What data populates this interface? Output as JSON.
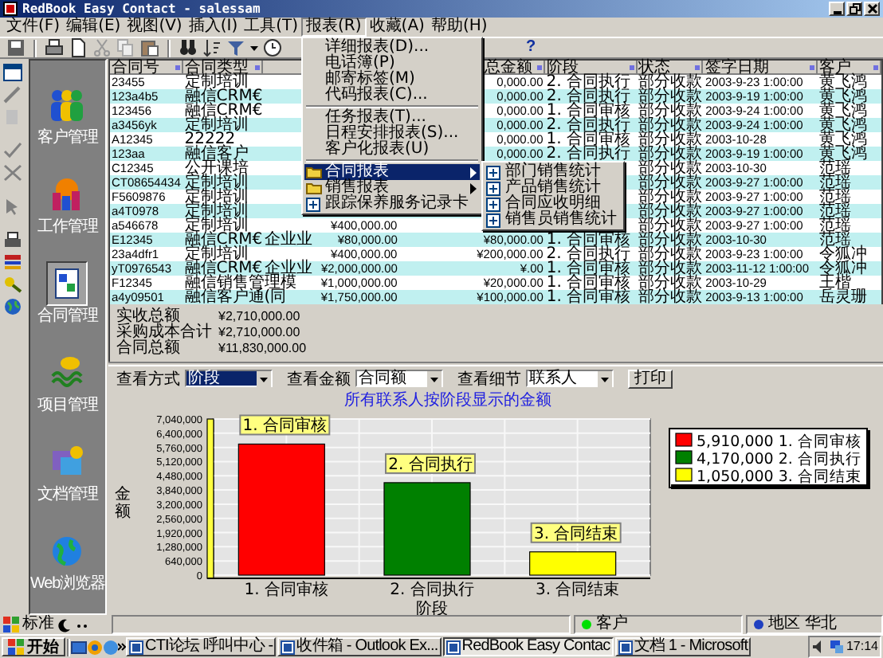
{
  "window": {
    "title": "RedBook Easy Contact - salessam"
  },
  "menu_bar": [
    {
      "label": "文件(F)",
      "selected": false
    },
    {
      "label": "编辑(E)",
      "selected": false
    },
    {
      "label": "视图(V)",
      "selected": false
    },
    {
      "label": "插入(I)",
      "selected": false
    },
    {
      "label": "工具(T)",
      "selected": false
    },
    {
      "label": "报表(R)",
      "selected": true
    },
    {
      "label": "收藏(A)",
      "selected": false
    },
    {
      "label": "帮助(H)",
      "selected": false
    }
  ],
  "toolbar": {
    "help": "?"
  },
  "report_menu": [
    {
      "kind": "item",
      "label": "详细报表(D)...",
      "selected": false
    },
    {
      "kind": "item",
      "label": "电话簿(P)",
      "selected": false
    },
    {
      "kind": "item",
      "label": "邮寄标签(M)",
      "selected": false
    },
    {
      "kind": "item",
      "label": "代码报表(C)...",
      "selected": false
    },
    {
      "kind": "separator"
    },
    {
      "kind": "item",
      "label": "任务报表(T)...",
      "selected": false
    },
    {
      "kind": "item",
      "label": "日程安排报表(S)...",
      "selected": false
    },
    {
      "kind": "item",
      "label": "客户化报表(U)",
      "selected": false
    },
    {
      "kind": "separator"
    },
    {
      "kind": "folder",
      "label": "合同报表",
      "selected": true
    },
    {
      "kind": "folder",
      "label": "销售报表",
      "selected": false
    },
    {
      "kind": "report",
      "label": "跟踪保养服务记录卡",
      "selected": false
    }
  ],
  "submenu": [
    {
      "label": "部门销售统计"
    },
    {
      "label": "产品销售统计"
    },
    {
      "label": "合同应收明细"
    },
    {
      "label": "销售员销售统计"
    }
  ],
  "sidebar": [
    {
      "label": "客户管理",
      "selected": false
    },
    {
      "label": "工作管理",
      "selected": false
    },
    {
      "label": "合同管理",
      "selected": true
    },
    {
      "label": "项目管理",
      "selected": false
    },
    {
      "label": "文档管理",
      "selected": false
    },
    {
      "label": "Web浏览器",
      "selected": false
    }
  ],
  "table": {
    "columns": {
      "column_1": "合同号",
      "column_2": "合同类型",
      "column_5": "总金额",
      "column_6": "阶段",
      "column_7": "状态",
      "column_8": "签字日期",
      "column_9": "客户"
    },
    "rows": [
      {
        "column_1": "23455",
        "column_2": "定制培训",
        "column_5": "0,000.00",
        "column_6": "2. 合同执行",
        "column_7": "部分收款",
        "column_8": "2003-9-23 1:00:00",
        "column_9": "黄飞鸿"
      },
      {
        "column_1": "123a4b5",
        "column_2": "融信CRM€",
        "column_5": "0,000.00",
        "column_6": "2. 合同执行",
        "column_7": "部分收款",
        "column_8": "2003-9-19 1:00:00",
        "column_9": "黄飞鸿"
      },
      {
        "column_1": "123456",
        "column_2": "融信CRM€",
        "column_5": "0,000.00",
        "column_6": "1. 合同审核",
        "column_7": "部分收款",
        "column_8": "2003-9-24 1:00:00",
        "column_9": "黄飞鸿"
      },
      {
        "column_1": "a3456yk",
        "column_2": "定制培训",
        "column_5": "0,000.00",
        "column_6": "2. 合同执行",
        "column_7": "部分收款",
        "column_8": "2003-9-24 1:00:00",
        "column_9": "黄飞鸿"
      },
      {
        "column_1": "A12345",
        "column_2": "22222",
        "column_5": "0,000.00",
        "column_6": "1. 合同审核",
        "column_7": "部分收款",
        "column_8": "2003-10-28",
        "column_9": "黄飞鸿"
      },
      {
        "column_1": "123aa",
        "column_2": "融信客户",
        "column_5": "0,000.00",
        "column_6": "2. 合同执行",
        "column_7": "部分收款",
        "column_8": "2003-9-19 1:00:00",
        "column_9": "黄飞鸿"
      },
      {
        "column_1": "C12345",
        "column_2": "公开课培",
        "column_7": "部分收款",
        "column_8": "2003-10-30",
        "column_9": "范瑶"
      },
      {
        "column_1": "CT08654434",
        "column_2": "定制培训",
        "column_7": "部分收款",
        "column_8": "2003-9-27 1:00:00",
        "column_9": "范瑶"
      },
      {
        "column_1": "F5609876",
        "column_2": "定制培训",
        "column_7": "部分收款",
        "column_8": "2003-9-27 1:00:00",
        "column_9": "范瑶"
      },
      {
        "column_1": "a4T0978",
        "column_2": "定制培训",
        "column_7": "部分收款",
        "column_8": "2003-9-27 1:00:00",
        "column_9": "范瑶"
      },
      {
        "column_1": "a546678",
        "column_2": "定制培训",
        "column_4": "¥400,000.00",
        "column_7": "部分收款",
        "column_8": "2003-9-27 1:00:00",
        "column_9": "范瑶"
      },
      {
        "column_1": "E12345",
        "column_2": "融信CRM€",
        "column_3": "企业业",
        "column_4": "¥80,000.00",
        "column_5": "¥80,000.00",
        "column_6": "1. 合同审核",
        "column_7": "部分收款",
        "column_8": "2003-10-30",
        "column_9": "范瑶"
      },
      {
        "column_1": "23a4dfr1",
        "column_2": "定制培训",
        "column_4": "¥400,000.00",
        "column_5": "¥200,000.00",
        "column_6": "2. 合同执行",
        "column_7": "部分收款",
        "column_8": "2003-9-23 1:00:00",
        "column_9": "令狐冲"
      },
      {
        "column_1": "yT0976543",
        "column_2": "融信CRM€",
        "column_3": "企业业",
        "column_4": "¥2,000,000.00",
        "column_5": "¥.00",
        "column_6": "1. 合同审核",
        "column_7": "部分收款",
        "column_8": "2003-11-12 1:00:00",
        "column_9": "令狐冲"
      },
      {
        "column_1": "F12345",
        "column_2": "融信销售管理模",
        "column_4": "¥1,000,000.00",
        "column_5": "¥20,000.00",
        "column_6": "1. 合同审核",
        "column_7": "部分收款",
        "column_8": "2003-10-29",
        "column_9": "王楷"
      },
      {
        "column_1": "a4y09501",
        "column_2": "融信客户通(同",
        "column_4": "¥1,750,000.00",
        "column_5": "¥100,000.00",
        "column_6": "1. 合同审核",
        "column_7": "部分收款",
        "column_8": "2003-9-13 1:00:00",
        "column_9": "岳灵珊"
      }
    ]
  },
  "totals": [
    {
      "label": "实收总额",
      "value": "¥2,710,000.00"
    },
    {
      "label": "采购成本合计",
      "value": "¥2,710,000.00"
    },
    {
      "label": "合同总额",
      "value": "¥11,830,000.00"
    }
  ],
  "view_controls": [
    {
      "label": "查看方式",
      "value": "阶段",
      "highlighted": true
    },
    {
      "label": "查看金额",
      "value": "合同额",
      "highlighted": false
    },
    {
      "label": "查看细节",
      "value": "联系人",
      "highlighted": false
    }
  ],
  "print_button": "打印",
  "chart": {
    "chart_data": {
      "type": "bar",
      "title": "所有联系人按阶段显示的金额",
      "xlabel": "阶段",
      "ylabel": "金额",
      "categories": [
        "1. 合同审核",
        "2. 合同执行",
        "3. 合同结束"
      ],
      "series": [
        {
          "name": "1. 合同审核",
          "color": "#ff0000",
          "values": [
            5910000,
            null,
            null
          ]
        },
        {
          "name": "2. 合同执行",
          "color": "#008000",
          "values": [
            null,
            4170000,
            null
          ]
        },
        {
          "name": "3. 合同结束",
          "color": "#ffff00",
          "values": [
            null,
            null,
            1050000
          ]
        }
      ],
      "stacked": true,
      "ylim": [
        0,
        7040000
      ],
      "yticks": [
        {
          "value": 0,
          "label": "0"
        },
        {
          "value": 640000,
          "label": "640,000"
        },
        {
          "value": 1280000,
          "label": "1,280,000"
        },
        {
          "value": 1920000,
          "label": "1,920,000"
        },
        {
          "value": 2560000,
          "label": "2,560,000"
        },
        {
          "value": 3200000,
          "label": "3,200,000"
        },
        {
          "value": 3840000,
          "label": "3,840,000"
        },
        {
          "value": 4480000,
          "label": "4,480,000"
        },
        {
          "value": 5120000,
          "label": "5,120,000"
        },
        {
          "value": 5760000,
          "label": "5,760,000"
        },
        {
          "value": 6400000,
          "label": "6,400,000"
        },
        {
          "value": 7040000,
          "label": "7,040,000"
        }
      ],
      "grid": true,
      "annotations": [
        {
          "text": "1. 合同审核"
        },
        {
          "text": "2. 合同执行"
        },
        {
          "text": "3. 合同结束"
        }
      ]
    },
    "legend": [
      {
        "value": "5,910,000"
      },
      {
        "value": "4,170,000"
      },
      {
        "value": "1,050,000"
      }
    ]
  },
  "status_bar": {
    "toolbar_label": "标准",
    "items": [
      {
        "text": "客户",
        "color": "#00e000"
      },
      {
        "text": "地区 华北",
        "color": "#2040c0"
      }
    ]
  },
  "taskbar": {
    "start": "开始",
    "tasks": [
      {
        "label": "CTI论坛 呼叫中心 -",
        "selected": false
      },
      {
        "label": "收件箱 - Outlook Ex...",
        "selected": false
      },
      {
        "label": "RedBook Easy Contac",
        "selected": true
      },
      {
        "label": "文档 1 - Microsoft",
        "selected": false
      }
    ],
    "clock": "17:14"
  }
}
